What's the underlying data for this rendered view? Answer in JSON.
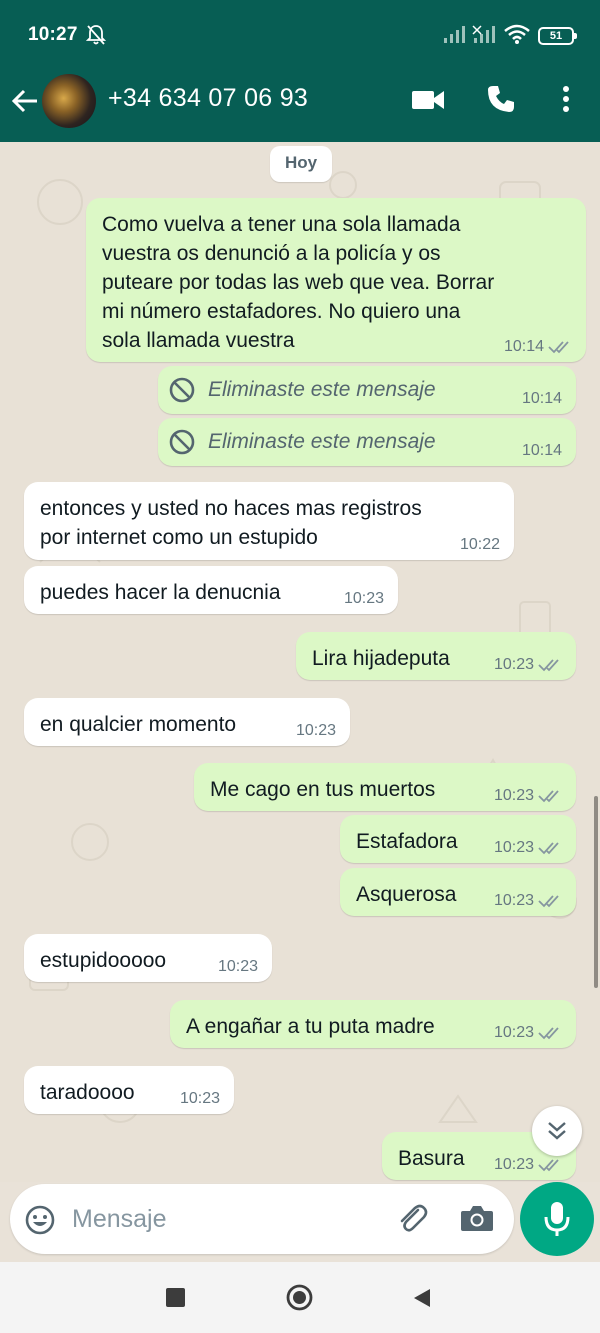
{
  "status_bar": {
    "time": "10:27",
    "battery": "51"
  },
  "header": {
    "contact_name": "+34 634 07 06 93"
  },
  "chat": {
    "date_label": "Hoy",
    "messages": [
      {
        "dir": "out",
        "lines": [
          "Como vuelva a tener una sola llamada",
          "vuestra os denunció a la policía y os",
          "puteare por todas las web que vea. Borrar",
          "mi número estafadores. No quiero una",
          "sola llamada vuestra"
        ],
        "time": "10:14",
        "status": "read"
      },
      {
        "dir": "out",
        "deleted": true,
        "text": "Eliminaste este mensaje",
        "time": "10:14"
      },
      {
        "dir": "out",
        "deleted": true,
        "text": "Eliminaste este mensaje",
        "time": "10:14"
      },
      {
        "dir": "in",
        "lines": [
          "entonces y usted no haces mas registros",
          "por internet como un estupido"
        ],
        "time": "10:22"
      },
      {
        "dir": "in",
        "text": "puedes hacer la denucnia",
        "time": "10:23"
      },
      {
        "dir": "out",
        "text": "Lira hijadeputa",
        "time": "10:23",
        "status": "read"
      },
      {
        "dir": "in",
        "text": "en qualcier momento",
        "time": "10:23"
      },
      {
        "dir": "out",
        "text": "Me cago en tus muertos",
        "time": "10:23",
        "status": "read"
      },
      {
        "dir": "out",
        "text": "Estafadora",
        "time": "10:23",
        "status": "read"
      },
      {
        "dir": "out",
        "text": "Asquerosa",
        "time": "10:23",
        "status": "read"
      },
      {
        "dir": "in",
        "text": "estupidooooo",
        "time": "10:23"
      },
      {
        "dir": "out",
        "text": "A engañar a tu puta madre",
        "time": "10:23",
        "status": "read"
      },
      {
        "dir": "in",
        "text": "taradoooo",
        "time": "10:23"
      },
      {
        "dir": "out",
        "text": "Basura",
        "time": "10:23",
        "status": "read"
      }
    ]
  },
  "composer": {
    "placeholder": "Mensaje"
  },
  "icons": {
    "back": "arrow-left-icon",
    "video": "video-camera-icon",
    "call": "phone-icon",
    "menu": "more-vert-icon",
    "emoji": "emoji-icon",
    "attach": "paperclip-icon",
    "camera": "camera-icon",
    "mic": "microphone-icon",
    "deleted": "block-icon",
    "ticks": "double-check-icon",
    "jump": "double-chevron-down-icon"
  },
  "colors": {
    "header": "#075e54",
    "outgoing_bubble": "#dcf8c6",
    "incoming_bubble": "#ffffff",
    "read_ticks": "#667781",
    "mic_button": "#00a884"
  }
}
